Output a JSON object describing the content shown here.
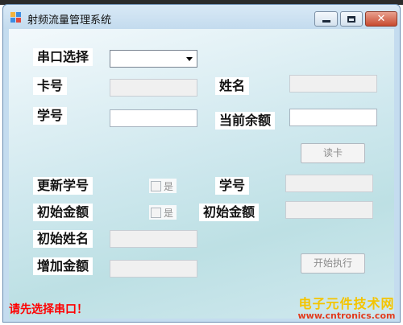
{
  "window": {
    "title": "射频流量管理系统"
  },
  "form": {
    "port_label": "串口选择",
    "port_value": "",
    "card_no_label": "卡号",
    "card_no_value": "",
    "name_label": "姓名",
    "name_value": "",
    "student_id_label": "学号",
    "student_id_value": "",
    "balance_label": "当前余额",
    "balance_value": "",
    "read_card_button": "读卡",
    "update_id_label": "更新学号",
    "update_id_checkbox": "是",
    "new_id_label": "学号",
    "new_id_value": "",
    "init_amount_label": "初始金额",
    "init_amount_checkbox": "是",
    "init_amount_label2": "初始金额",
    "init_amount_value": "",
    "init_name_label": "初始姓名",
    "init_name_value": "",
    "add_amount_label": "增加金额",
    "add_amount_value": "",
    "start_button": "开始执行"
  },
  "status": {
    "message": "请先选择串口！"
  },
  "watermark": {
    "line1": "电子元件技术网",
    "line2": "www.cntronics.com"
  }
}
